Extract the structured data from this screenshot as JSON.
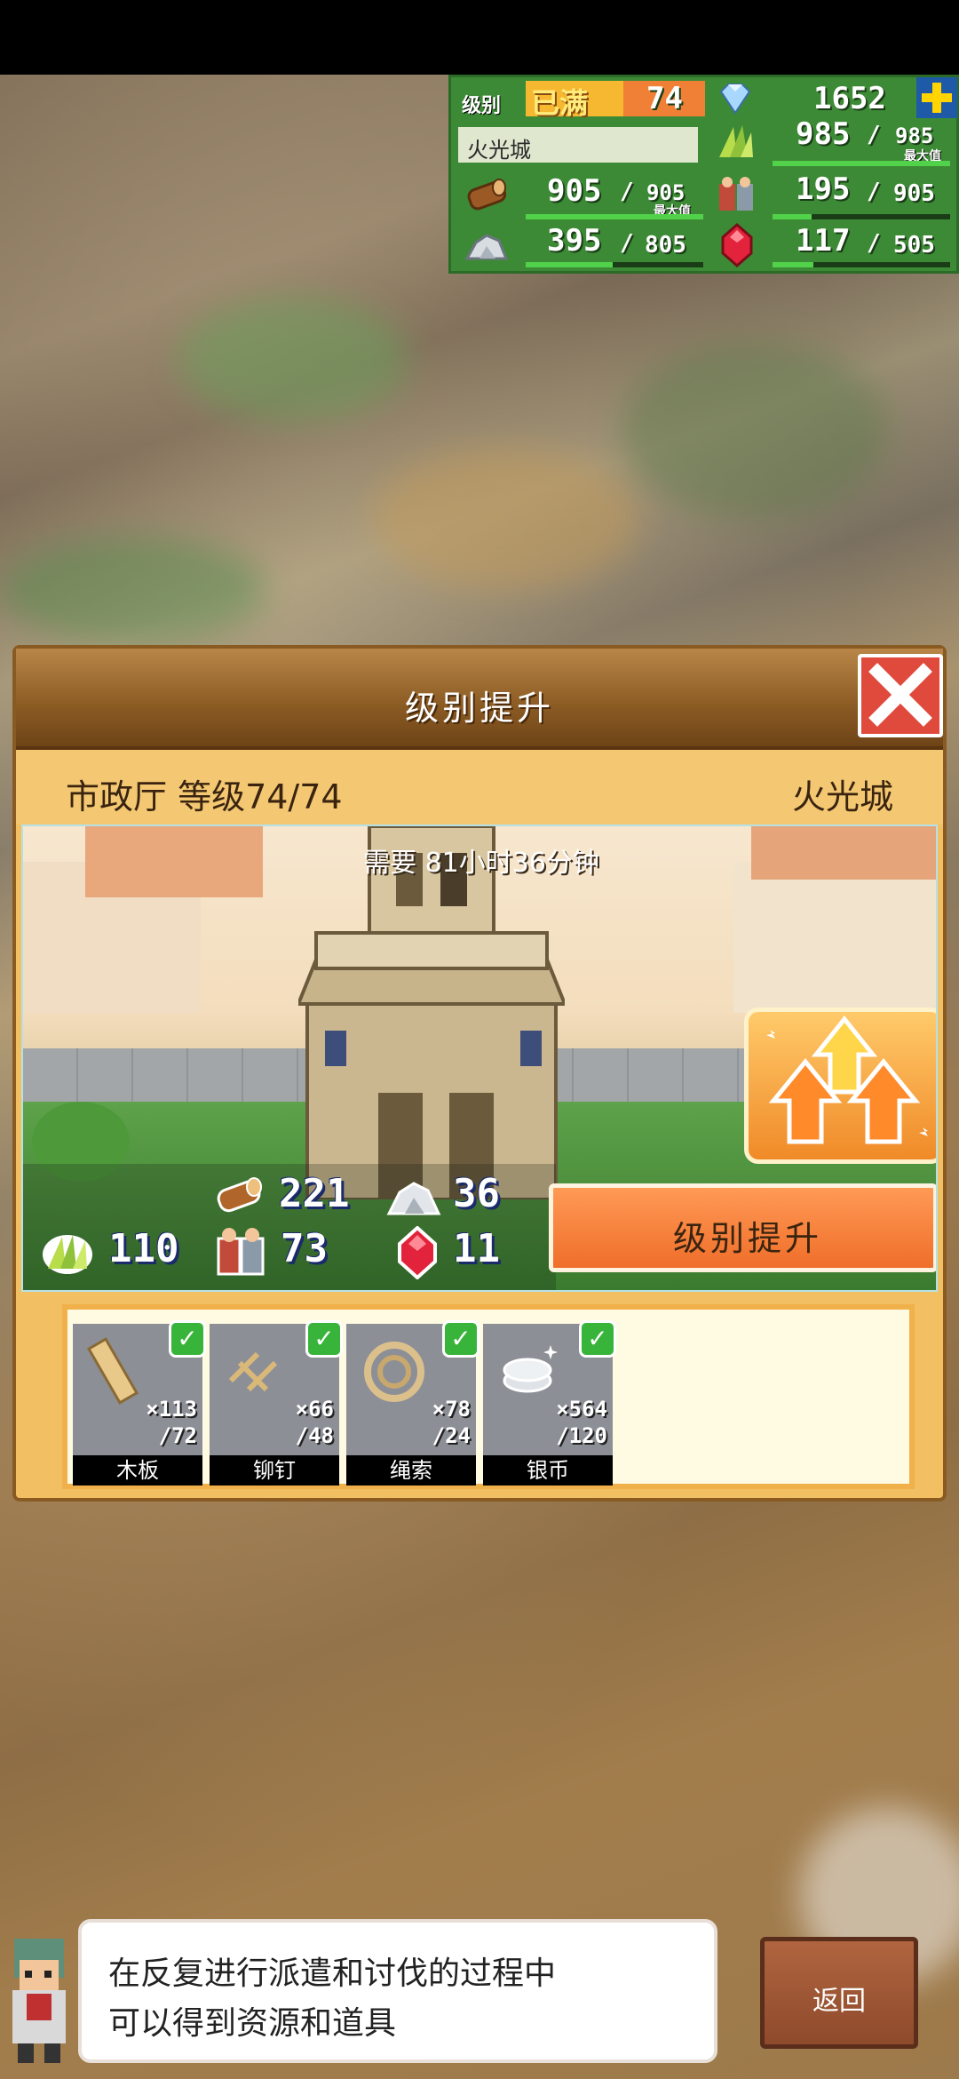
{
  "hud": {
    "level_label": "级别",
    "level_status": "已满",
    "level_value": "74",
    "gems": "1652",
    "plus_icon": "plus-icon",
    "town_name": "火光城",
    "food": {
      "current": "985",
      "max": "985",
      "max_tag": "最大值",
      "fill": 1.0
    },
    "wood": {
      "current": "905",
      "max": "905",
      "max_tag": "最大值",
      "fill": 1.0
    },
    "workers": {
      "current": "195",
      "max": "905",
      "fill": 0.22
    },
    "stone": {
      "current": "395",
      "max": "805",
      "fill": 0.49
    },
    "ruby": {
      "current": "117",
      "max": "505",
      "fill": 0.23
    }
  },
  "dialog": {
    "title": "级别提升",
    "building": "市政厅 等级74/74",
    "town": "火光城",
    "need_time": "需要 81小时36分钟",
    "costs": {
      "wood": "221",
      "stone": "36",
      "food": "110",
      "workers": "73",
      "ruby": "11"
    },
    "upgrade_button": "级别提升",
    "materials": [
      {
        "name": "木板",
        "have": "×113",
        "need": "/72"
      },
      {
        "name": "铆钉",
        "have": "×66",
        "need": "/48"
      },
      {
        "name": "绳索",
        "have": "×78",
        "need": "/24"
      },
      {
        "name": "银币",
        "have": "×564",
        "need": "/120"
      }
    ]
  },
  "tip": {
    "line1": "在反复进行派遣和讨伐的过程中",
    "line2": "可以得到资源和道具"
  },
  "back_button": "返回",
  "colors": {
    "hud_green": "#3c8a35",
    "upgrade_orange": "#ef6e2a",
    "close_red": "#e04a3d",
    "panel_gold": "#f2c062"
  }
}
